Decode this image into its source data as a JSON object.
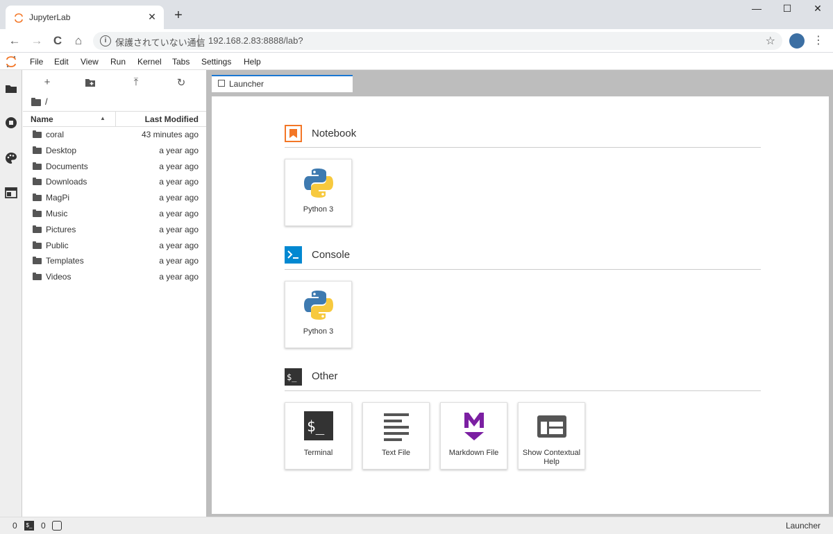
{
  "browser": {
    "tab_title": "JupyterLab",
    "close_glyph": "✕",
    "new_tab_glyph": "+",
    "security_label": "保護されていない通信",
    "url": "192.168.2.83:8888/lab?",
    "nav": {
      "back": "←",
      "forward": "→",
      "reload": "C",
      "home": "⌂"
    },
    "window_controls": {
      "minimize": "—",
      "maximize": "☐",
      "close": "✕"
    },
    "star_glyph": "☆",
    "menu_glyph": "⋮"
  },
  "menubar": {
    "items": [
      "File",
      "Edit",
      "View",
      "Run",
      "Kernel",
      "Tabs",
      "Settings",
      "Help"
    ]
  },
  "filebrowser": {
    "toolbar": {
      "new": "+",
      "upload": "⤒",
      "refresh": "↻"
    },
    "breadcrumb": "/",
    "columns": {
      "name": "Name",
      "modified": "Last Modified",
      "sort_arrow": "▲"
    },
    "files": [
      {
        "name": "coral",
        "modified": "43 minutes ago"
      },
      {
        "name": "Desktop",
        "modified": "a year ago"
      },
      {
        "name": "Documents",
        "modified": "a year ago"
      },
      {
        "name": "Downloads",
        "modified": "a year ago"
      },
      {
        "name": "MagPi",
        "modified": "a year ago"
      },
      {
        "name": "Music",
        "modified": "a year ago"
      },
      {
        "name": "Pictures",
        "modified": "a year ago"
      },
      {
        "name": "Public",
        "modified": "a year ago"
      },
      {
        "name": "Templates",
        "modified": "a year ago"
      },
      {
        "name": "Videos",
        "modified": "a year ago"
      }
    ]
  },
  "launcher": {
    "tab_title": "Launcher",
    "sections": {
      "notebook": {
        "title": "Notebook",
        "cards": [
          {
            "label": "Python 3"
          }
        ]
      },
      "console": {
        "title": "Console",
        "cards": [
          {
            "label": "Python 3"
          }
        ]
      },
      "other": {
        "title": "Other",
        "cards": [
          {
            "label": "Terminal"
          },
          {
            "label": "Text File"
          },
          {
            "label": "Markdown File"
          },
          {
            "label": "Show Contextual Help"
          }
        ]
      }
    }
  },
  "statusbar": {
    "terminals": "0",
    "kernels": "0",
    "term_glyph": "$_",
    "right_label": "Launcher"
  },
  "colors": {
    "accent": "#1976d2",
    "notebook_icon": "#f37626",
    "console_icon": "#0288d1",
    "markdown": "#7b1fa2"
  }
}
